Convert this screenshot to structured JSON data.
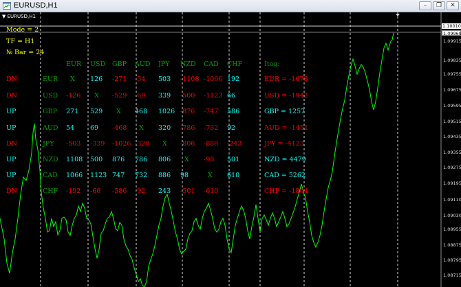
{
  "window": {
    "title": "EURUSD,H1"
  },
  "chart": {
    "symbol_label": "EURUSD,H1",
    "symbol_caret": "▼",
    "prices": [
      "1.10010",
      "1.09969",
      "1.09915",
      "1.09835",
      "1.09755",
      "1.09675",
      "1.09595",
      "1.09515",
      "1.09435",
      "1.09355",
      "1.09275",
      "1.09195",
      "1.09110",
      "1.09030",
      "1.08955",
      "1.08875",
      "1.08795",
      "1.08715"
    ],
    "current_price": "1.10010",
    "bid_price": "1.09969",
    "line_color": "#00ff00",
    "grid_color": "#ffffff"
  },
  "indicator": {
    "mode": "Mode = 2",
    "tf": "TF = H1",
    "bar": "№ Bar = 24",
    "columns": [
      "EUR",
      "USD",
      "GBP",
      "AUD",
      "JPY",
      "NZD",
      "CAD",
      "CHF"
    ],
    "result_header": "Itog:",
    "rows": [
      {
        "dir": "DN",
        "cur": "EUR",
        "cells": [
          "X",
          "126",
          "-271",
          "-54",
          "503",
          "-1108",
          "-1066",
          "192"
        ],
        "itog": "EUR = -1678"
      },
      {
        "dir": "DN",
        "cur": "USD",
        "cells": [
          "-126",
          "X",
          "-529",
          "-69",
          "339",
          "-500",
          "-1123",
          "66"
        ],
        "itog": "USD = -1942"
      },
      {
        "dir": "UP",
        "cur": "GBP",
        "cells": [
          "271",
          "529",
          "X",
          "468",
          "1026",
          "-876",
          "-747",
          "586"
        ],
        "itog": "GBP = 1257"
      },
      {
        "dir": "UP",
        "cur": "AUD",
        "cells": [
          "54",
          "69",
          "-468",
          "X",
          "320",
          "-786",
          "-732",
          "92"
        ],
        "itog": "AUD = -1451"
      },
      {
        "dir": "DN",
        "cur": "JPY",
        "cells": [
          "-503",
          "-339",
          "-1026",
          "-320",
          "X",
          "-806",
          "-886",
          "-243"
        ],
        "itog": "JPY = -4123"
      },
      {
        "dir": "UP",
        "cur": "NZD",
        "cells": [
          "1108",
          "500",
          "876",
          "786",
          "806",
          "X",
          "-98",
          "501"
        ],
        "itog": "NZD = 4479"
      },
      {
        "dir": "UP",
        "cur": "CAD",
        "cells": [
          "1066",
          "1123",
          "747",
          "732",
          "886",
          "98",
          "X",
          "610"
        ],
        "itog": "CAD = 5262"
      },
      {
        "dir": "DN",
        "cur": "CHF",
        "cells": [
          "-192",
          "-66",
          "-586",
          "-92",
          "243",
          "-501",
          "-610",
          ""
        ],
        "itog": "CHF = -1804"
      }
    ]
  }
}
